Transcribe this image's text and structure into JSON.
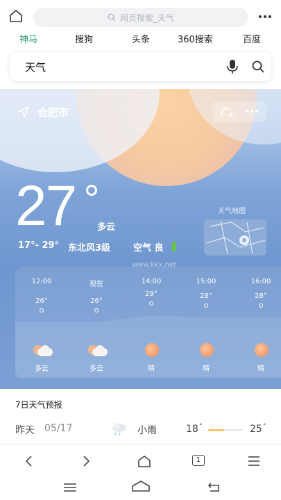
{
  "topbar": {
    "search_placeholder": "网页搜索_天气"
  },
  "engines": [
    {
      "label": "神马",
      "active": true
    },
    {
      "label": "搜狗",
      "active": false
    },
    {
      "label": "头条",
      "active": false
    },
    {
      "label": "360搜索",
      "active": false
    },
    {
      "label": "百度",
      "active": false
    }
  ],
  "search": {
    "query": "天气"
  },
  "weather": {
    "city": "合肥市",
    "temperature": "27",
    "condition": "多云",
    "temp_range": "17°- 29°",
    "wind": "东北风3级",
    "air_quality": "空气 良",
    "map_label": "天气地图",
    "watermark": "www.kkx.net",
    "hourly": [
      {
        "time": "12:00",
        "temp": "26°",
        "temp_value": 26,
        "condition": "多云",
        "icon": "partly-cloudy-icon"
      },
      {
        "time": "现在",
        "temp": "26°",
        "temp_value": 26,
        "condition": "多云",
        "icon": "partly-cloudy-icon"
      },
      {
        "time": "14:00",
        "temp": "29°",
        "temp_value": 29,
        "condition": "晴",
        "icon": "sunny-icon"
      },
      {
        "time": "15:00",
        "temp": "28°",
        "temp_value": 28,
        "condition": "晴",
        "icon": "sunny-icon"
      },
      {
        "time": "16:00",
        "temp": "28°",
        "temp_value": 28,
        "condition": "晴",
        "icon": "sunny-icon"
      }
    ]
  },
  "forecast": {
    "title": "7日天气预报",
    "rows": [
      {
        "day": "昨天",
        "date": "05/17",
        "condition": "小雨",
        "low": "18",
        "high": "25",
        "icon": "light-rain-icon",
        "bar_fill": 0.45
      }
    ]
  },
  "browser_nav": {
    "tab_count": "1"
  },
  "colors": {
    "engine_active": "#2a9c6b",
    "sun": "#f08a5a",
    "aqi_good": "#6cc24a"
  }
}
